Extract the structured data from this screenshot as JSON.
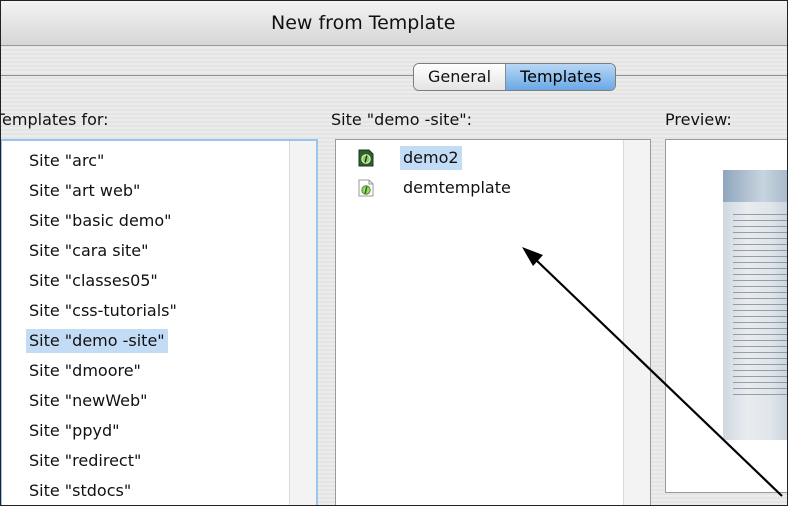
{
  "window": {
    "title": "New from Template"
  },
  "tabs": [
    {
      "label": "General",
      "selected": false
    },
    {
      "label": "Templates",
      "selected": true
    }
  ],
  "sites_panel": {
    "label": "Templates for:",
    "items": [
      "Site \"arc\"",
      "Site \"art web\"",
      "Site \"basic demo\"",
      "Site \"cara site\"",
      "Site \"classes05\"",
      "Site \"css-tutorials\"",
      "Site \"demo -site\"",
      "Site \"dmoore\"",
      "Site \"newWeb\"",
      "Site \"ppyd\"",
      "Site \"redirect\"",
      "Site \"stdocs\""
    ],
    "selected_index": 6
  },
  "templates_panel": {
    "label": "Site \"demo -site\":",
    "items": [
      {
        "name": "demo2",
        "icon": "dreamweaver-template-icon",
        "selected": true
      },
      {
        "name": "demtemplate",
        "icon": "dreamweaver-template-icon",
        "selected": false
      }
    ]
  },
  "preview_panel": {
    "label": "Preview:"
  },
  "colors": {
    "selection": "#c3dcf6",
    "tab_selected": "#6aa8e6",
    "focus_ring": "#9cc3ee"
  }
}
